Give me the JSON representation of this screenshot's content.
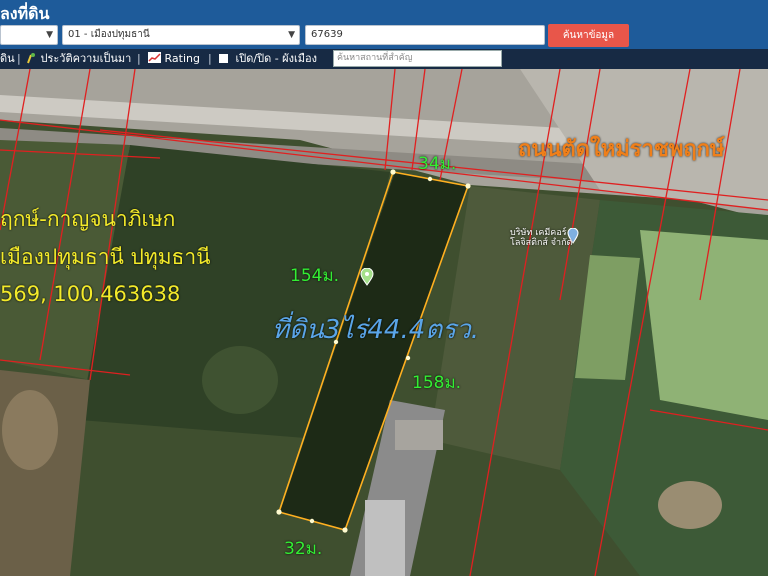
{
  "header": {
    "title": "ลงที่ดิน",
    "district_value": "01 - เมืองปทุมธานี",
    "parcel_value": "67639",
    "search_button": "ค้นหาข้อมูล"
  },
  "toolbar": {
    "item_land": "ดิน",
    "item_flood": "ประวัติความเป็นมา",
    "item_rating": "Rating",
    "item_plan": "เปิด/ปิด - ผังเมือง",
    "search_placeholder": "ค้นหาสถานที่สำคัญ"
  },
  "map": {
    "road_label": "ถนนตัดใหม่ราชพฤกษ์",
    "address_line1": "ฤกษ์-กาญจนาภิเษก",
    "address_line2": "เมืองปทุมธานี ปทุมธานี",
    "address_line3": "569, 100.463638",
    "area_label": "ที่ดิน3ไร่44.4ตรว.",
    "dim_top": "34ม.",
    "dim_left": "154ม.",
    "dim_right": "158ม.",
    "dim_bottom": "32ม.",
    "poi_line1": "บริษัท เคมีคอร์",
    "poi_line2": "โลจิสติกส์ จำกัด"
  },
  "colors": {
    "header_bg": "#1e5b9a",
    "toolbar_bg": "#172a44",
    "button": "#e8564a",
    "parcel_outline": "#ffb020",
    "boundary_lines": "#e02020",
    "dim_text": "#33ee33",
    "area_text": "#5aa5e8",
    "road_text": "#ef7f1a",
    "address_text": "#f3ea2a"
  },
  "icons": [
    "map-pin-icon",
    "chart-icon",
    "rating-icon",
    "checkbox-icon",
    "poi-marker-icon",
    "chevron-down-icon"
  ]
}
